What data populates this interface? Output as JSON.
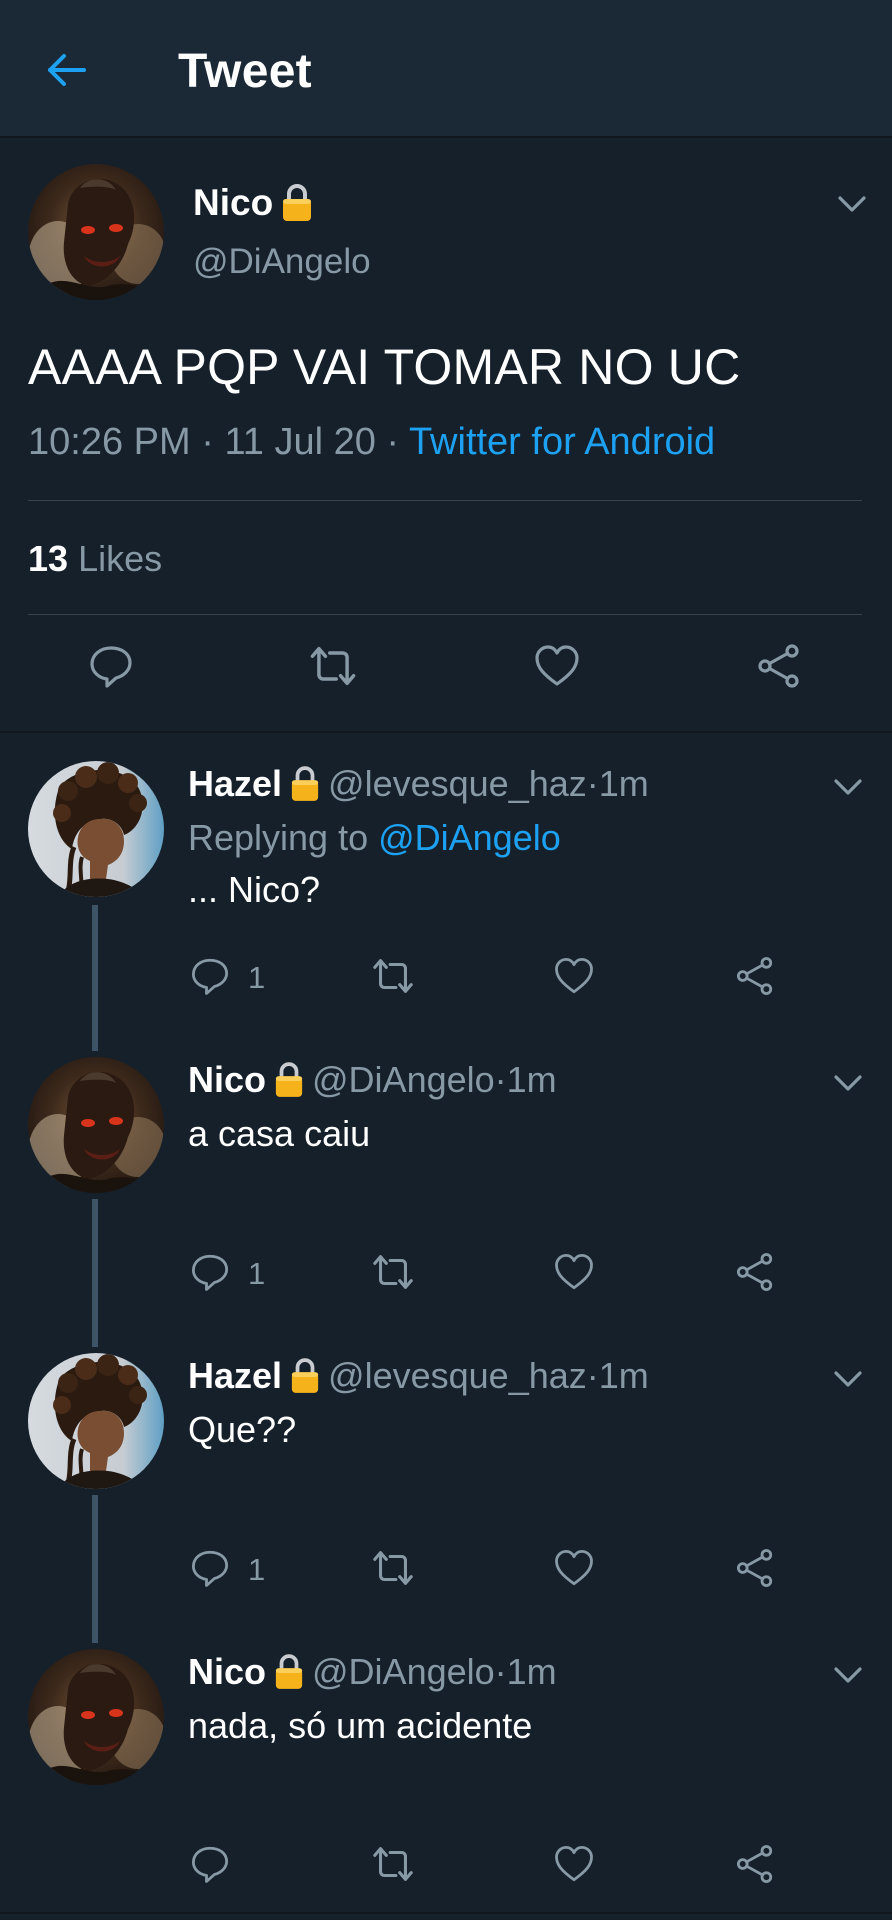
{
  "header": {
    "title": "Tweet",
    "back_icon": "arrow-left-icon"
  },
  "colors": {
    "background": "#15202b",
    "header": "#1b2836",
    "accent": "#1da1f2",
    "muted": "#8899a6",
    "lock": "#f5b21a"
  },
  "main_tweet": {
    "name": "Nico",
    "handle": "@DiAngelo",
    "text": "AAAA PQP VAI TOMAR NO UC",
    "time": "10:26 PM",
    "sep1": " · ",
    "date": "11 Jul 20",
    "sep2": " · ",
    "source": "Twitter for Android",
    "likes_count": "13",
    "likes_label": "Likes"
  },
  "replies": [
    {
      "name": "Hazel",
      "handle": "@levesque_haz",
      "sep": " · ",
      "time": "1m",
      "replying_label": "Replying to ",
      "replying_to": "@DiAngelo",
      "text": "... Nico?",
      "reply_count": "1"
    },
    {
      "name": "Nico",
      "handle": "@DiAngelo",
      "sep": " · ",
      "time": "1m",
      "text": "a casa caiu",
      "reply_count": "1"
    },
    {
      "name": "Hazel",
      "handle": "@levesque_haz",
      "sep": " · ",
      "time": "1m",
      "text": "Que??",
      "reply_count": "1"
    },
    {
      "name": "Nico",
      "handle": "@DiAngelo",
      "sep": " · ",
      "time": "1m",
      "text": "nada, só um acidente",
      "reply_count": ""
    }
  ]
}
